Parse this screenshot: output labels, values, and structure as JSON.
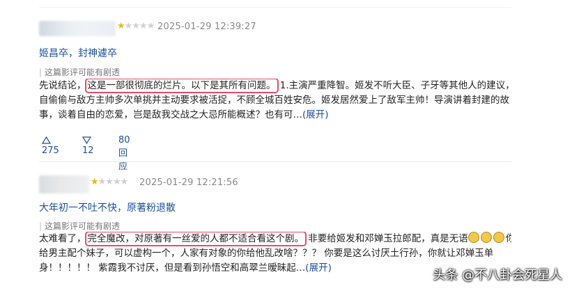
{
  "reviews": [
    {
      "rating_stars": 1,
      "rating_max": 5,
      "time": "2025-01-29 12:39:27",
      "title": "姬昌卒，封神遽卒",
      "spoiler_note": "这篇影评可能有剧透",
      "lines": [
        {
          "pre": "先说结论，",
          "hl": "这是一部很彻底的烂片。以下是其所有问题。",
          "post": " 1.主演严重降智。姬发不听大臣、子牙等其他人的建议，亲"
        },
        {
          "text": "自偷偷与敌方主帅多次单挑并主动要求被活捉，不顾全城百姓安危。姬发居然爱上了敌军主帅！导演讲着封建的故"
        },
        {
          "text": "事，谈着自由的恋爱，岂是敌我交战之大忌所能概述？也有可…"
        }
      ],
      "expand_label": "(展开)",
      "useful_count": "275",
      "useless_count": "12",
      "reply_label": "80回应"
    },
    {
      "rating_stars": 1,
      "rating_max": 5,
      "time": "2025-01-29 12:21:56",
      "title": "大年初一不吐不快，原著粉退散",
      "spoiler_note": "这篇影评可能有剧透",
      "lines": [
        {
          "pre": "太难看了，",
          "hl": "完全魔改，对原著有一丝爱的人都不适合看这个剧。",
          "post": " 非要给姬发和邓婵玉拉郎配，真是无语",
          "emoji_count": 3,
          "post2": "你想"
        },
        {
          "text": "给男主配个妹子，可以虚构一个，人家有对象的你给他乱改啥？？？ 你要是这么讨厌土行孙，你就让邓婵玉单"
        },
        {
          "text": "身！！！！！ 紫霞我不讨厌，但是看到孙悟空和高翠兰暧昧起…"
        }
      ],
      "expand_label": "(展开)"
    }
  ],
  "watermark": "头条 @不八卦会死星人",
  "colors": {
    "link": "#1a4f9e",
    "highlight_box": "#e84a6b",
    "star": "#f7b500"
  }
}
